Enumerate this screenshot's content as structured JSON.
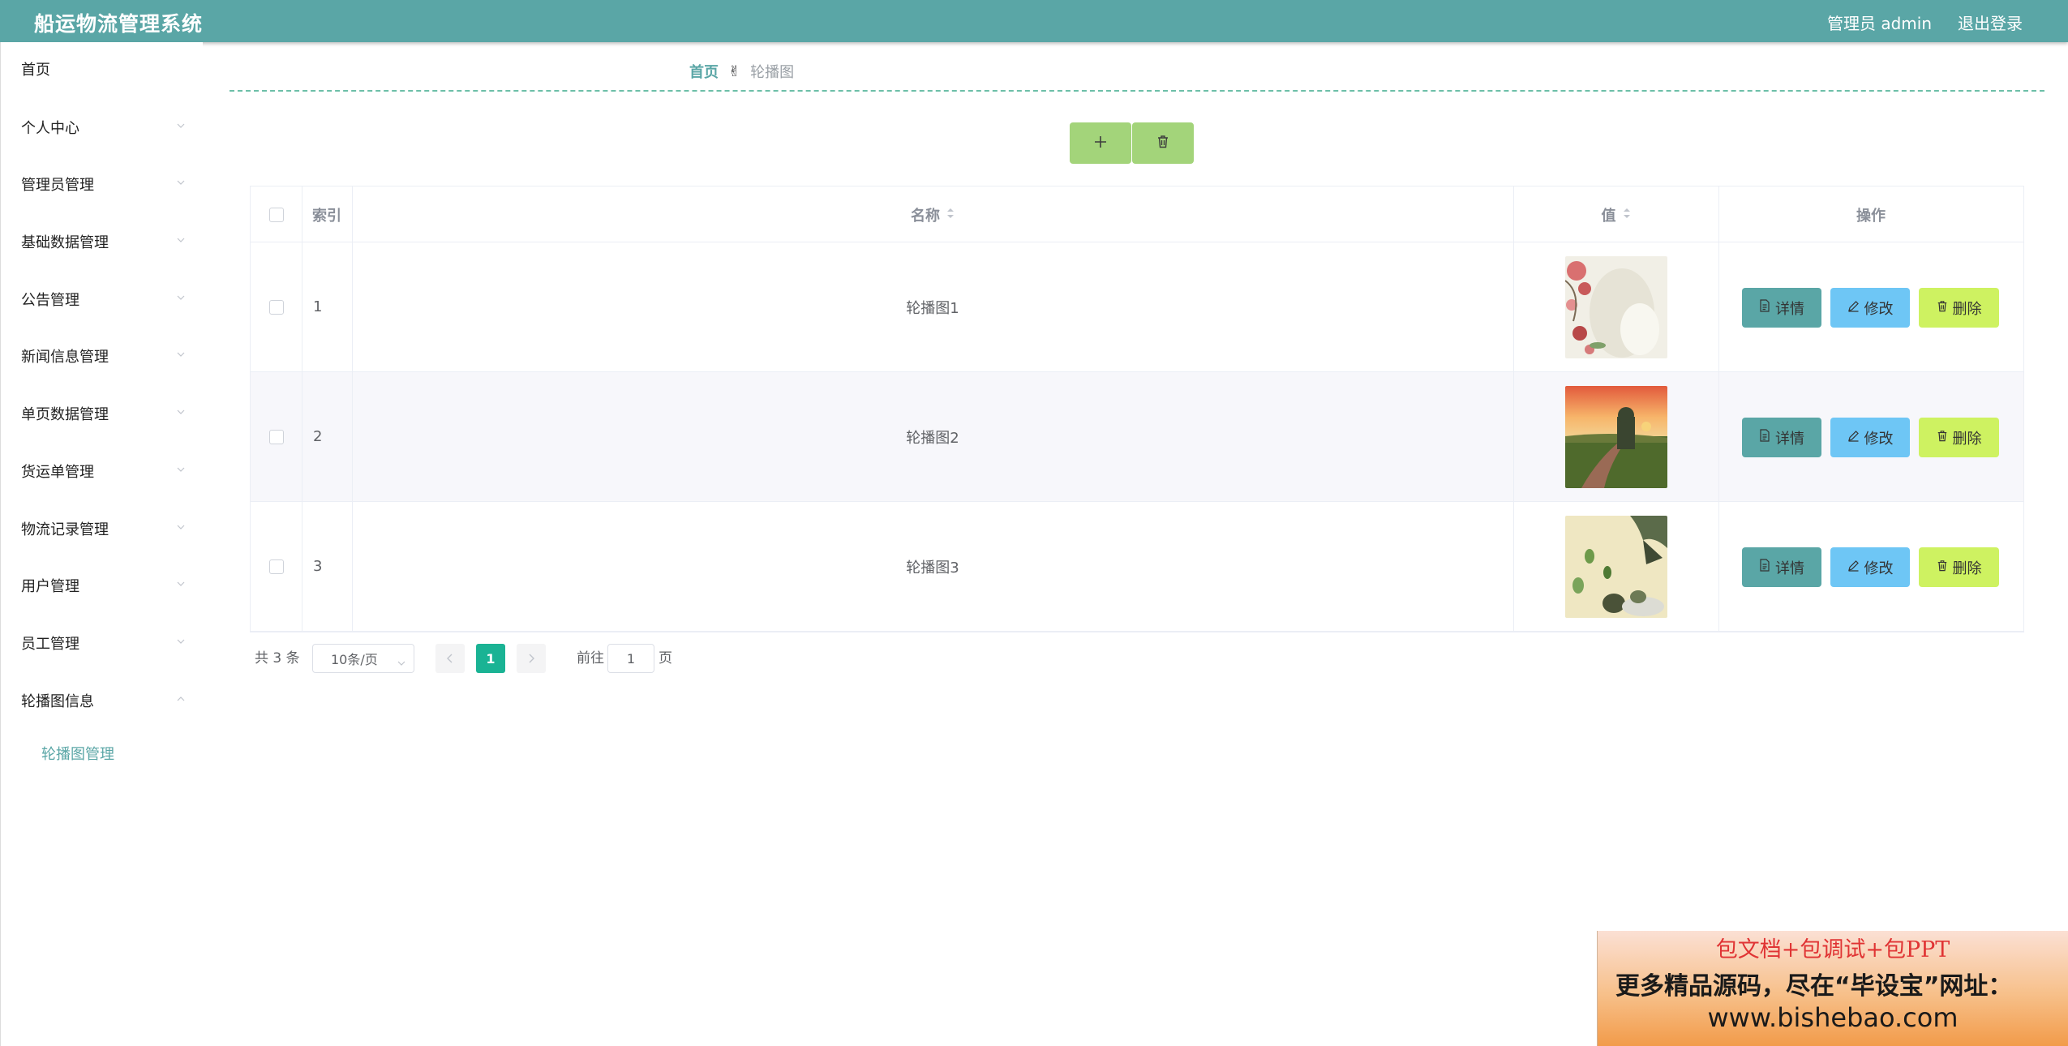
{
  "header": {
    "title": "船运物流管理系统",
    "admin_label": "管理员 admin",
    "logout_label": "退出登录"
  },
  "sidebar": {
    "items": [
      {
        "label": "首页"
      },
      {
        "label": "个人中心"
      },
      {
        "label": "管理员管理"
      },
      {
        "label": "基础数据管理"
      },
      {
        "label": "公告管理"
      },
      {
        "label": "新闻信息管理"
      },
      {
        "label": "单页数据管理"
      },
      {
        "label": "货运单管理"
      },
      {
        "label": "物流记录管理"
      },
      {
        "label": "用户管理"
      },
      {
        "label": "员工管理"
      },
      {
        "label": "轮播图信息"
      }
    ],
    "subitem": "轮播图管理"
  },
  "breadcrumb": {
    "home": "首页",
    "separator": "✌",
    "current": "轮播图"
  },
  "toolbar": {
    "add_icon": "plus-icon",
    "delete_icon": "trash-icon"
  },
  "table": {
    "columns": {
      "index": "索引",
      "name": "名称",
      "value": "值",
      "actions": "操作"
    },
    "rows": [
      {
        "index": "1",
        "name": "轮播图1",
        "image": "banner-image-flowers"
      },
      {
        "index": "2",
        "name": "轮播图2",
        "image": "banner-image-sunset-road"
      },
      {
        "index": "3",
        "name": "轮播图3",
        "image": "banner-image-ink-landscape"
      }
    ],
    "actions": {
      "detail": "详情",
      "edit": "修改",
      "delete": "删除"
    }
  },
  "pagination": {
    "total": "共 3 条",
    "page_size": "10条/页",
    "current_page": "1",
    "goto_label": "前往",
    "goto_value": "1",
    "page_suffix": "页"
  },
  "ad": {
    "line1": "包文档+包调试+包PPT",
    "line2": "更多精品源码，尽在“毕设宝”网址：",
    "line3": "www.bishebao.com"
  },
  "colors": {
    "primary": "#5aa6a6",
    "toolbar_button": "#a3d47a",
    "edit_button": "#6ec6f5",
    "delete_button": "#cef261",
    "page_active": "#1ab394"
  }
}
